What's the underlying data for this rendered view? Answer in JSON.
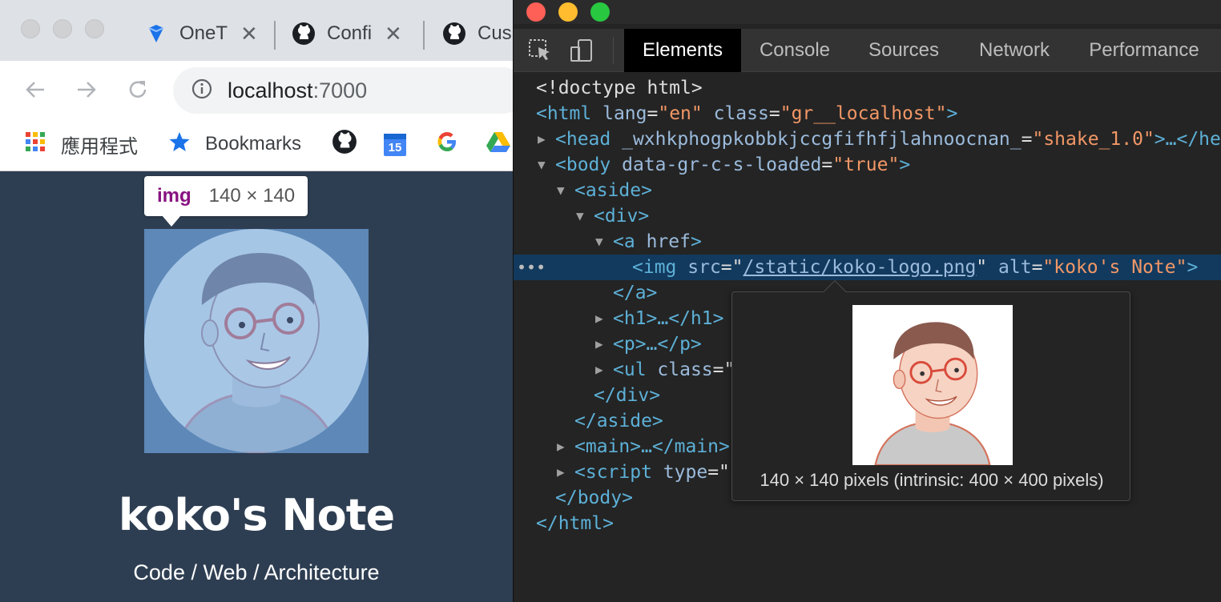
{
  "browser": {
    "tabs": [
      {
        "title": "OneT",
        "icon": "diamond-icon"
      },
      {
        "title": "Confi",
        "icon": "github-icon"
      },
      {
        "title": "Cus",
        "icon": "github-icon"
      }
    ],
    "address": {
      "host": "localhost",
      "port": ":7000"
    },
    "bookmarks": [
      {
        "label": "應用程式",
        "icon": "apps-grid-icon"
      },
      {
        "label": "Bookmarks",
        "icon": "star-icon"
      },
      {
        "label": "",
        "icon": "github-icon"
      },
      {
        "label": "",
        "icon": "calendar-icon",
        "badge": "15"
      },
      {
        "label": "",
        "icon": "google-icon"
      },
      {
        "label": "",
        "icon": "drive-icon"
      }
    ],
    "inspect_tooltip": {
      "tag": "img",
      "size": "140 × 140"
    },
    "site": {
      "title": "koko's Note",
      "subtitle": "Code / Web / Architecture"
    }
  },
  "devtools": {
    "tabs": [
      "Elements",
      "Console",
      "Sources",
      "Network",
      "Performance"
    ],
    "active_tab": "Elements",
    "dom": {
      "doctype": "<!doctype html>",
      "html_open": {
        "tag": "<html",
        "attr1": "lang",
        "val1": "\"en\"",
        "attr2": "class",
        "val2": "\"gr__localhost\"",
        "close": ">"
      },
      "head": {
        "tag": "<head",
        "attr": "_wxhkphogpkobbkjccgfifhfjlahnoocnan_",
        "val": "\"shake_1.0\"",
        "close": ">…</head>"
      },
      "body_open": {
        "tag": "<body",
        "attr": "data-gr-c-s-loaded",
        "val": "\"true\"",
        "close": ">"
      },
      "aside_open": "<aside>",
      "div_open": "<div>",
      "a_open": {
        "tag": "<a",
        "attr": "href",
        "close": ">"
      },
      "img": {
        "tag": "<img",
        "attr1": "src",
        "val1": "/static/koko-logo.png",
        "attr2": "alt",
        "val2": "\"koko's Note\"",
        "close": ">"
      },
      "a_close": "</a>",
      "h1": "<h1>…</h1>",
      "p": "<p>…</p>",
      "ul": {
        "tag": "<ul",
        "attr": "class",
        "val": "=\""
      },
      "div_close": "</div>",
      "aside_close": "</aside>",
      "main": "<main>…</main>",
      "script": {
        "tag": "<script",
        "attr": "type",
        "val": "=\""
      },
      "body_close": "</body>",
      "html_close": "</html>"
    },
    "preview_caption": "140 × 140 pixels (intrinsic: 400 × 400 pixels)"
  },
  "colors": {
    "page_bg": "#2e3e52",
    "avatar_overlay": "#a6c6e6",
    "selected_row": "#123a5e",
    "tag_color": "#5db0d7",
    "value_color": "#f29766"
  }
}
